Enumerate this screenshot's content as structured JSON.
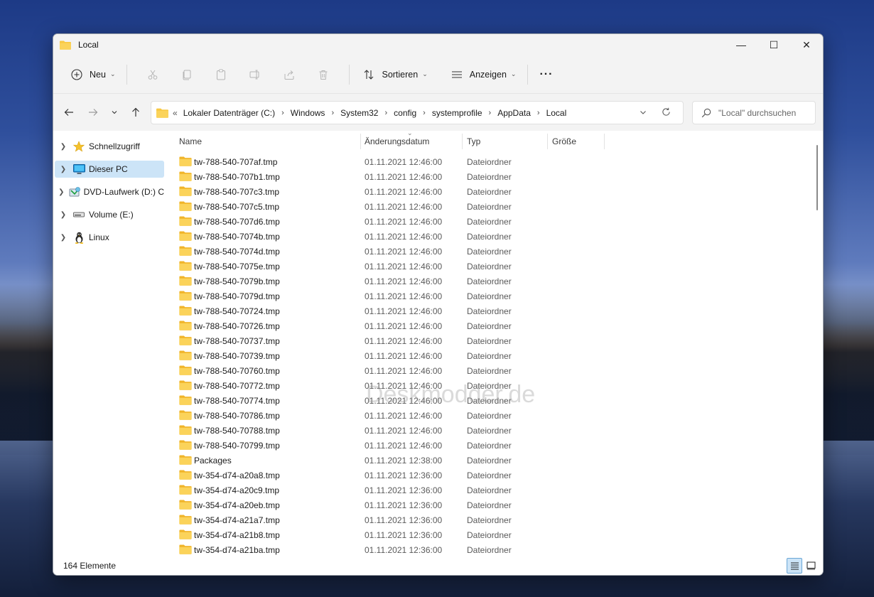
{
  "window": {
    "title": "Local"
  },
  "window_controls": {
    "minimize": "—",
    "maximize": "☐",
    "close": "✕"
  },
  "toolbar": {
    "new_label": "Neu",
    "sort_label": "Sortieren",
    "view_label": "Anzeigen",
    "more_label": "···"
  },
  "address": {
    "prefix": "«",
    "crumbs": [
      "Lokaler Datenträger (C:)",
      "Windows",
      "System32",
      "config",
      "systemprofile",
      "AppData",
      "Local"
    ]
  },
  "search": {
    "placeholder": "\"Local\" durchsuchen"
  },
  "sidebar": {
    "items": [
      {
        "label": "Schnellzugriff",
        "icon": "star-icon"
      },
      {
        "label": "Dieser PC",
        "icon": "pc-icon",
        "selected": true
      },
      {
        "label": "DVD-Laufwerk (D:) C",
        "icon": "dvd-icon"
      },
      {
        "label": "Volume (E:)",
        "icon": "drive-icon"
      },
      {
        "label": "Linux",
        "icon": "linux-icon"
      }
    ]
  },
  "columns": {
    "name": "Name",
    "date": "Änderungsdatum",
    "type": "Typ",
    "size": "Größe"
  },
  "files": [
    {
      "name": "tw-788-540-707af.tmp",
      "date": "01.11.2021 12:46:00",
      "type": "Dateiordner"
    },
    {
      "name": "tw-788-540-707b1.tmp",
      "date": "01.11.2021 12:46:00",
      "type": "Dateiordner"
    },
    {
      "name": "tw-788-540-707c3.tmp",
      "date": "01.11.2021 12:46:00",
      "type": "Dateiordner"
    },
    {
      "name": "tw-788-540-707c5.tmp",
      "date": "01.11.2021 12:46:00",
      "type": "Dateiordner"
    },
    {
      "name": "tw-788-540-707d6.tmp",
      "date": "01.11.2021 12:46:00",
      "type": "Dateiordner"
    },
    {
      "name": "tw-788-540-7074b.tmp",
      "date": "01.11.2021 12:46:00",
      "type": "Dateiordner"
    },
    {
      "name": "tw-788-540-7074d.tmp",
      "date": "01.11.2021 12:46:00",
      "type": "Dateiordner"
    },
    {
      "name": "tw-788-540-7075e.tmp",
      "date": "01.11.2021 12:46:00",
      "type": "Dateiordner"
    },
    {
      "name": "tw-788-540-7079b.tmp",
      "date": "01.11.2021 12:46:00",
      "type": "Dateiordner"
    },
    {
      "name": "tw-788-540-7079d.tmp",
      "date": "01.11.2021 12:46:00",
      "type": "Dateiordner"
    },
    {
      "name": "tw-788-540-70724.tmp",
      "date": "01.11.2021 12:46:00",
      "type": "Dateiordner"
    },
    {
      "name": "tw-788-540-70726.tmp",
      "date": "01.11.2021 12:46:00",
      "type": "Dateiordner"
    },
    {
      "name": "tw-788-540-70737.tmp",
      "date": "01.11.2021 12:46:00",
      "type": "Dateiordner"
    },
    {
      "name": "tw-788-540-70739.tmp",
      "date": "01.11.2021 12:46:00",
      "type": "Dateiordner"
    },
    {
      "name": "tw-788-540-70760.tmp",
      "date": "01.11.2021 12:46:00",
      "type": "Dateiordner"
    },
    {
      "name": "tw-788-540-70772.tmp",
      "date": "01.11.2021 12:46:00",
      "type": "Dateiordner"
    },
    {
      "name": "tw-788-540-70774.tmp",
      "date": "01.11.2021 12:46:00",
      "type": "Dateiordner"
    },
    {
      "name": "tw-788-540-70786.tmp",
      "date": "01.11.2021 12:46:00",
      "type": "Dateiordner"
    },
    {
      "name": "tw-788-540-70788.tmp",
      "date": "01.11.2021 12:46:00",
      "type": "Dateiordner"
    },
    {
      "name": "tw-788-540-70799.tmp",
      "date": "01.11.2021 12:46:00",
      "type": "Dateiordner"
    },
    {
      "name": "Packages",
      "date": "01.11.2021 12:38:00",
      "type": "Dateiordner"
    },
    {
      "name": "tw-354-d74-a20a8.tmp",
      "date": "01.11.2021 12:36:00",
      "type": "Dateiordner"
    },
    {
      "name": "tw-354-d74-a20c9.tmp",
      "date": "01.11.2021 12:36:00",
      "type": "Dateiordner"
    },
    {
      "name": "tw-354-d74-a20eb.tmp",
      "date": "01.11.2021 12:36:00",
      "type": "Dateiordner"
    },
    {
      "name": "tw-354-d74-a21a7.tmp",
      "date": "01.11.2021 12:36:00",
      "type": "Dateiordner"
    },
    {
      "name": "tw-354-d74-a21b8.tmp",
      "date": "01.11.2021 12:36:00",
      "type": "Dateiordner"
    },
    {
      "name": "tw-354-d74-a21ba.tmp",
      "date": "01.11.2021 12:36:00",
      "type": "Dateiordner"
    }
  ],
  "status": {
    "count": "164 Elemente"
  },
  "watermark": "Deskmodder.de",
  "colors": {
    "accent": "#0067c0",
    "selection": "#cce4f7",
    "folder": "#f8c843"
  }
}
